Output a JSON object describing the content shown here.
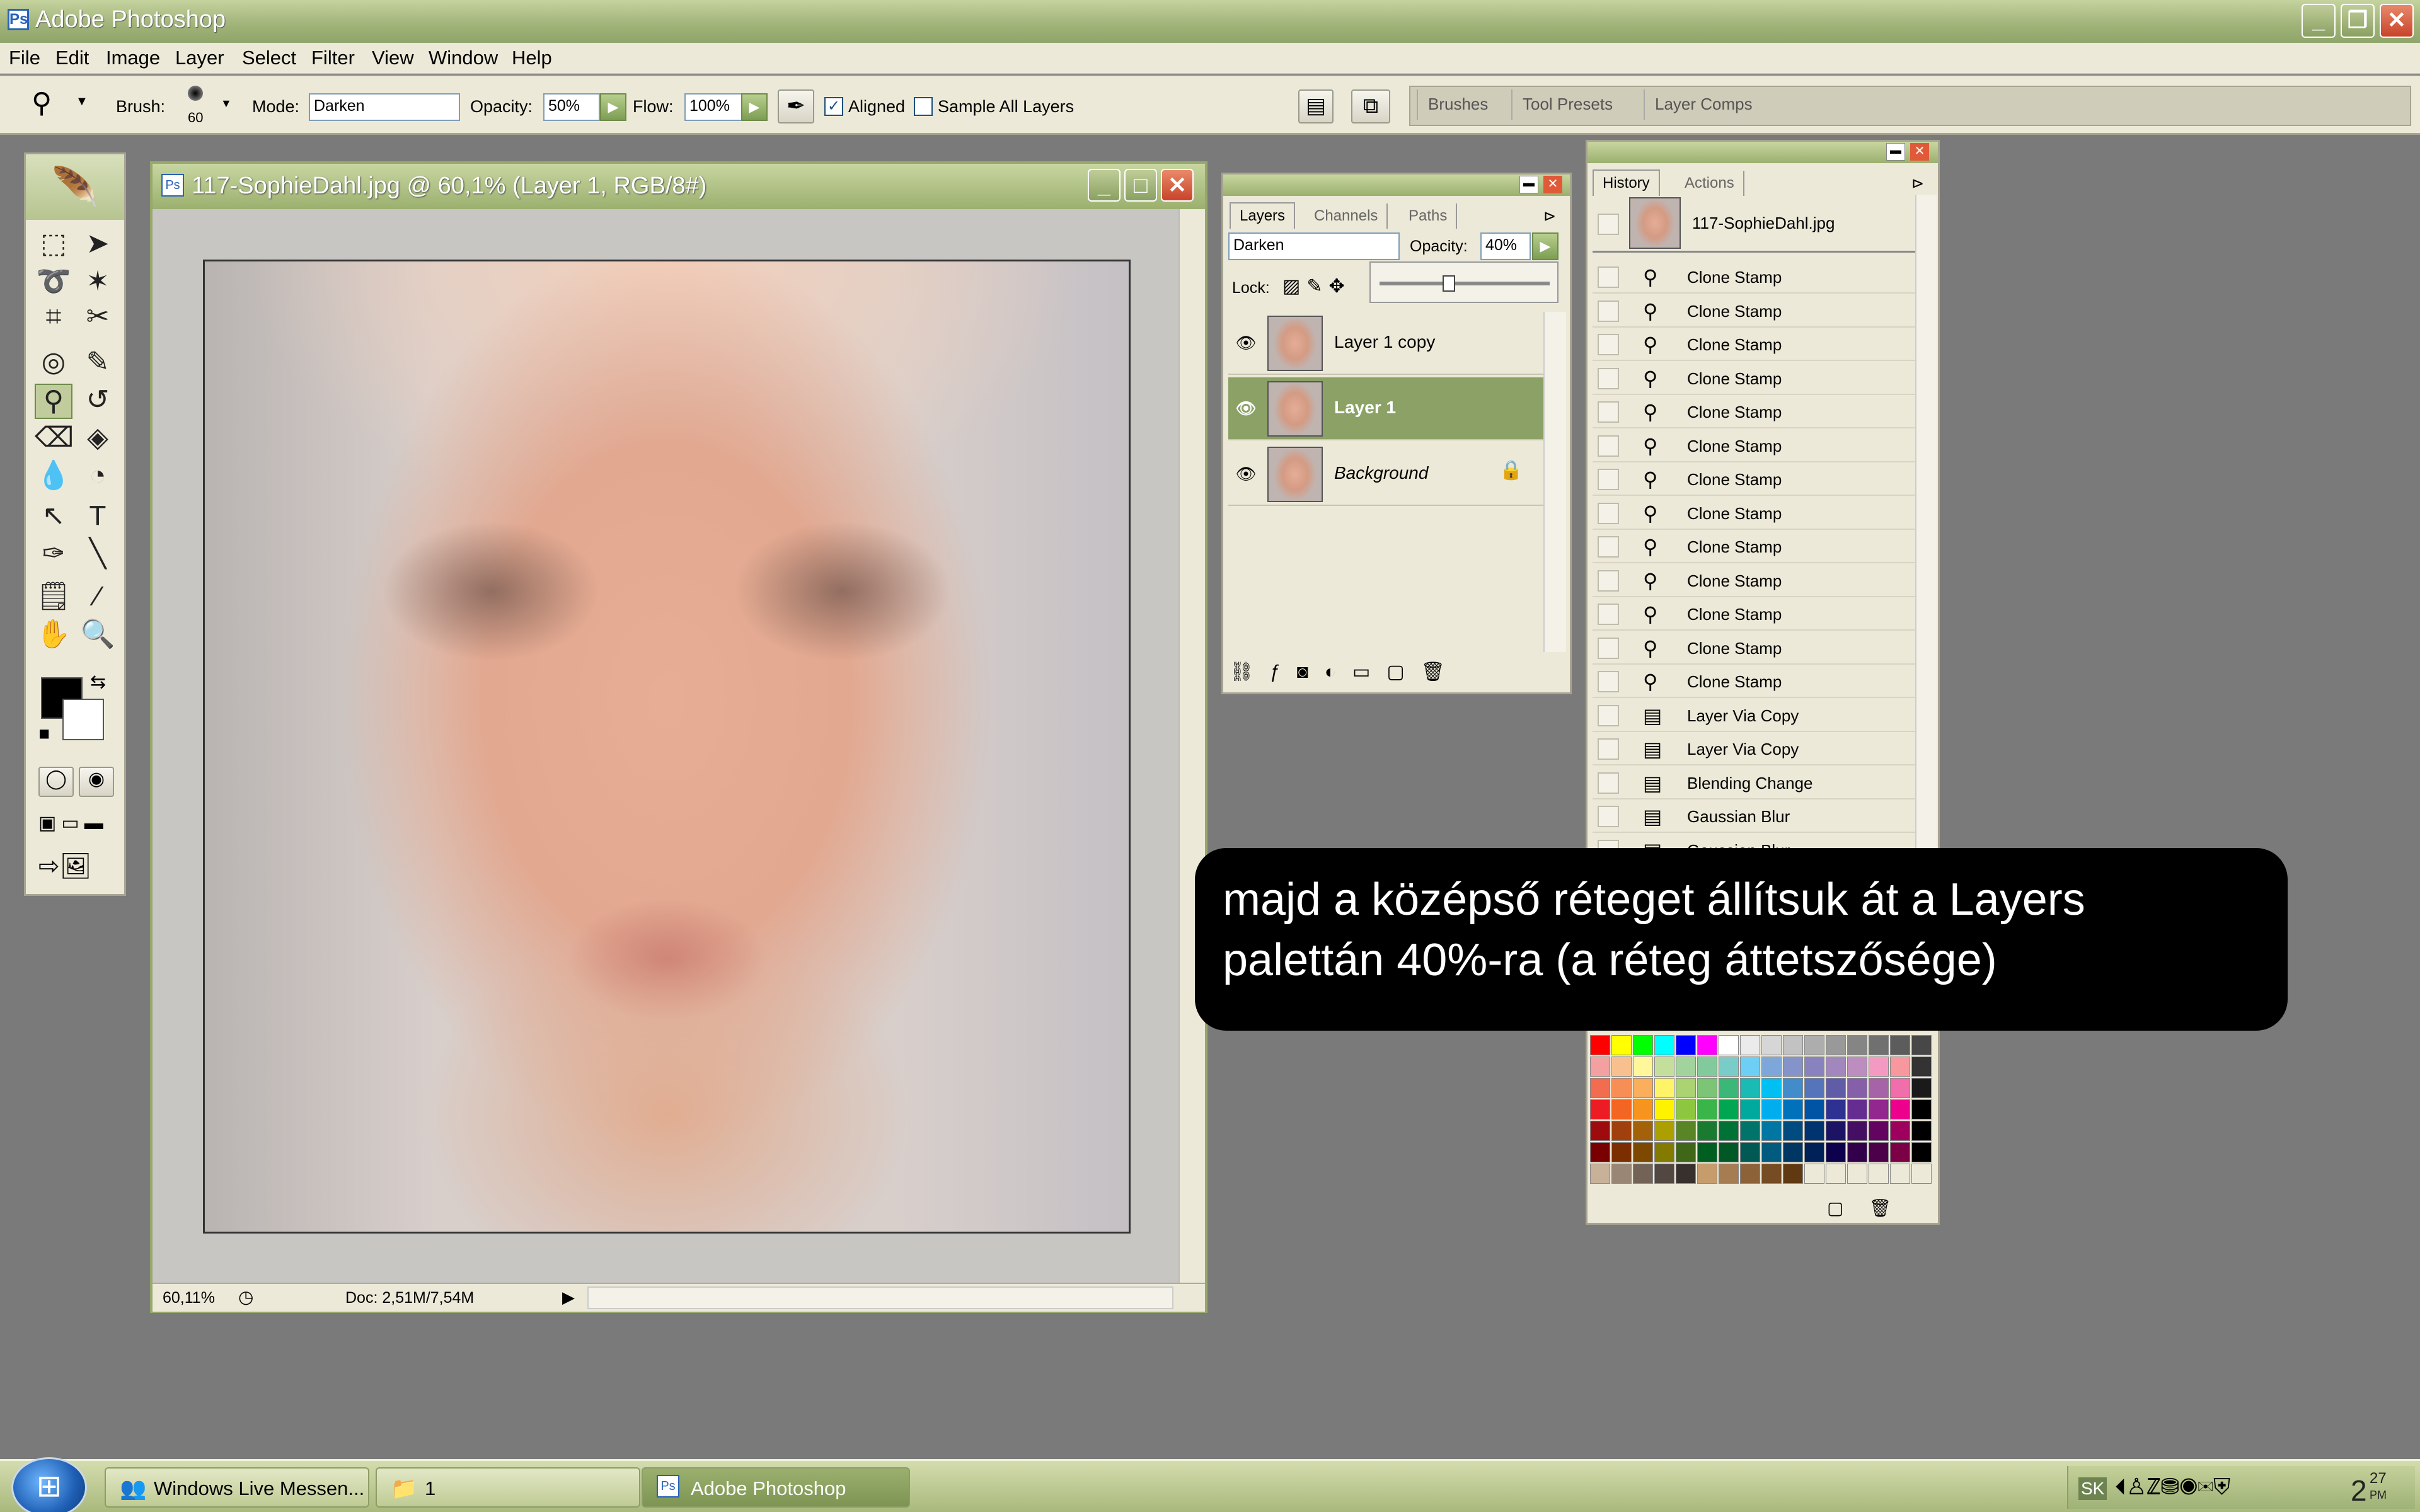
{
  "app": {
    "title": "Adobe Photoshop"
  },
  "menubar": [
    "File",
    "Edit",
    "Image",
    "Layer",
    "Select",
    "Filter",
    "View",
    "Window",
    "Help"
  ],
  "options": {
    "brush_label": "Brush:",
    "brush_size": "60",
    "mode_label": "Mode:",
    "mode_value": "Darken",
    "opacity_label": "Opacity:",
    "opacity_value": "50%",
    "flow_label": "Flow:",
    "flow_value": "100%",
    "aligned_label": "Aligned",
    "aligned_checked": true,
    "sample_all_label": "Sample All Layers",
    "sample_all_checked": false,
    "well_tabs": [
      "Brushes",
      "Tool Presets",
      "Layer Comps"
    ]
  },
  "document": {
    "title": "117-SophieDahl.jpg @ 60,1% (Layer 1, RGB/8#)",
    "zoom": "60,11%",
    "doc_info": "Doc: 2,51M/7,54M"
  },
  "layers_panel": {
    "tabs": [
      "Layers",
      "Channels",
      "Paths"
    ],
    "blend_mode": "Darken",
    "opacity_label": "Opacity:",
    "opacity_value": "40%",
    "opacity_fraction": 0.4,
    "lock_label": "Lock:",
    "layers": [
      {
        "name": "Layer 1 copy",
        "selected": false
      },
      {
        "name": "Layer 1",
        "selected": true
      },
      {
        "name": "Background",
        "selected": false
      }
    ]
  },
  "history_panel": {
    "tabs": [
      "History",
      "Actions"
    ],
    "snapshot": "117-SophieDahl.jpg",
    "items": [
      "Clone Stamp",
      "Clone Stamp",
      "Clone Stamp",
      "Clone Stamp",
      "Clone Stamp",
      "Clone Stamp",
      "Clone Stamp",
      "Clone Stamp",
      "Clone Stamp",
      "Clone Stamp",
      "Clone Stamp",
      "Clone Stamp",
      "Clone Stamp",
      "Layer Via Copy",
      "Layer Via Copy",
      "Blending Change",
      "Gaussian Blur",
      "Gaussian Blur"
    ]
  },
  "caption": {
    "line1": "majd a középső réteget állítsuk át a Layers",
    "line2": "palettán 40%-ra (a réteg áttetszősége)"
  },
  "taskbar": {
    "tasks": [
      "Windows Live Messen...",
      "1",
      "Adobe Photoshop"
    ],
    "lang": "SK",
    "clock": "2",
    "clock_min": "27",
    "clock_ampm": "PM"
  },
  "colors": {
    "accent": "#8ca166",
    "title": "#9fb277",
    "panel": "#ece9d8"
  },
  "icons": [
    "photoshop-icon",
    "stamp-icon",
    "eye-icon",
    "lock-icon",
    "start-icon"
  ]
}
